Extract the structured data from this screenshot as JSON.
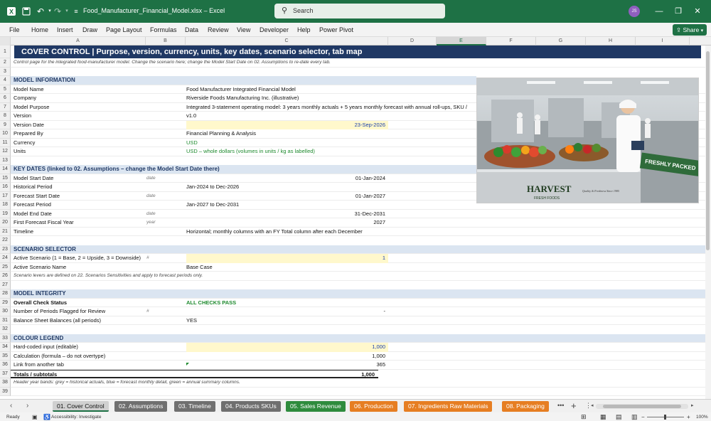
{
  "window": {
    "filename": "Food_Manufacturer_Financial_Model.xlsx",
    "app": "Excel",
    "search_placeholder": "Search",
    "user_initials": "JS"
  },
  "menu": [
    "File",
    "Home",
    "Insert",
    "Draw",
    "Page Layout",
    "Formulas",
    "Data",
    "Review",
    "View",
    "Developer",
    "Help",
    "Power Pivot"
  ],
  "share_label": "Share",
  "columns": [
    "A",
    "B",
    "C",
    "D",
    "E",
    "F",
    "G",
    "H",
    "I"
  ],
  "rows": {
    "r1": "COVER CONTROL | Purpose, version, currency, units, key dates, scenario selector, tab map",
    "r2": "Control page for the integrated food-manufacturer model. Change the scenario here; change the Model Start Date on 02. Assumptions to re-date every tab.",
    "r4": "MODEL INFORMATION",
    "r5": [
      "Model Name",
      "Food Manufacturer Integrated Financial Model"
    ],
    "r6": [
      "Company",
      "Riverside Foods Manufacturing Inc. (illustrative)"
    ],
    "r7": [
      "Model Purpose",
      "Integrated 3-statement operating model: 3 years monthly actuals + 5 years monthly forecast with annual roll-ups, SKU /"
    ],
    "r8": [
      "Version",
      "v1.0"
    ],
    "r9": [
      "Version Date",
      "23-Sep-2026"
    ],
    "r10": [
      "Prepared By",
      "Financial Planning & Analysis"
    ],
    "r11": [
      "Currency",
      "USD"
    ],
    "r12": [
      "Units",
      "USD – whole dollars (volumes in units / kg as labelled)"
    ],
    "r14": "KEY DATES (linked to 02. Assumptions – change the Model Start Date there)",
    "r15": [
      "Model Start Date",
      "date",
      "01-Jan-2024"
    ],
    "r16": [
      "Historical Period",
      "Jan-2024 to Dec-2026"
    ],
    "r17": [
      "Forecast Start Date",
      "date",
      "01-Jan-2027"
    ],
    "r18": [
      "Forecast Period",
      "Jan-2027 to Dec-2031"
    ],
    "r19": [
      "Model End Date",
      "date",
      "31-Dec-2031"
    ],
    "r20": [
      "First Forecast Fiscal Year",
      "year",
      "2027"
    ],
    "r21": [
      "Timeline",
      "Horizontal; monthly columns with an FY Total column after each December"
    ],
    "r23": "SCENARIO SELECTOR",
    "r24": [
      "Active Scenario (1 = Base, 2 = Upside, 3 = Downside)",
      "#",
      "1"
    ],
    "r25": [
      "Active Scenario Name",
      "Base Case"
    ],
    "r26": "Scenario levers are defined on 22. Scenarios Sensitivities and apply to forecast periods only.",
    "r28": "MODEL INTEGRITY",
    "r29": [
      "Overall Check Status",
      "ALL CHECKS PASS"
    ],
    "r30": [
      "Number of Periods Flagged for Review",
      "#",
      "-"
    ],
    "r31": [
      "Balance Sheet Balances (all periods)",
      "YES"
    ],
    "r33": "COLOUR LEGEND",
    "r34": [
      "Hard-coded input (editable)",
      "1,000"
    ],
    "r35": [
      "Calculation (formula – do not overtype)",
      "1,000"
    ],
    "r36": [
      "Link from another tab",
      "365"
    ],
    "r37": [
      "Totals / subtotals",
      "1,000"
    ],
    "r38": "Header year bands: grey = historical actuals, blue = forecast monthly detail, green = annual summary columns."
  },
  "photo": {
    "brand": "HARVEST",
    "brand_sub": "FRESH FOODS",
    "sign": "FRESHLY PACKED",
    "tag": "Quality & Freshness Since 1985"
  },
  "tabs": [
    {
      "label": "01. Cover Control",
      "color": "#d0d0d0",
      "text": "#111",
      "active": true
    },
    {
      "label": "02. Assumptions",
      "color": "#6f6f6f",
      "text": "#fff"
    },
    {
      "label": "03. Timeline",
      "color": "#6f6f6f",
      "text": "#fff"
    },
    {
      "label": "04. Products SKUs",
      "color": "#6f6f6f",
      "text": "#fff"
    },
    {
      "label": "05. Sales Revenue",
      "color": "#2e8b3d",
      "text": "#fff"
    },
    {
      "label": "06. Production",
      "color": "#e67e22",
      "text": "#fff"
    },
    {
      "label": "07. Ingredients Raw Materials",
      "color": "#e67e22",
      "text": "#fff"
    },
    {
      "label": "08. Packaging",
      "color": "#e67e22",
      "text": "#fff"
    }
  ],
  "status": {
    "ready": "Ready",
    "accessibility": "Accessibility: Investigate",
    "zoom": "100%"
  }
}
